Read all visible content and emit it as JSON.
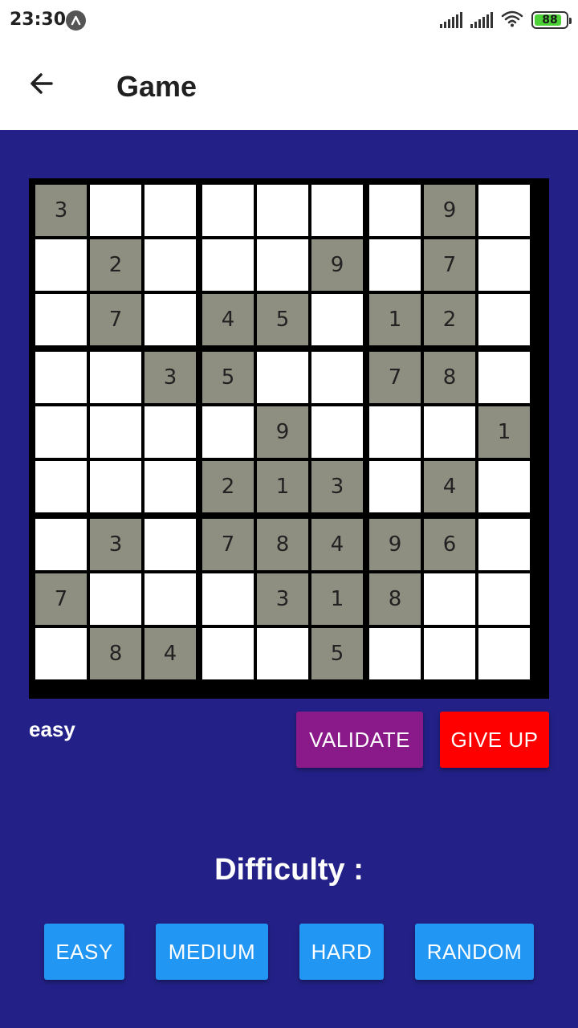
{
  "status_bar": {
    "time": "23:30",
    "battery_level": "88",
    "icons": [
      "app-notification-icon",
      "signal-icon",
      "signal-icon",
      "wifi-icon",
      "battery-icon"
    ]
  },
  "app_bar": {
    "title": "Game",
    "back_icon": "arrow-left-icon"
  },
  "colors": {
    "background": "#232187",
    "given_cell": "#8f8f81",
    "validate_button": "#8a1a8a",
    "give_up_button": "#ff0000",
    "difficulty_button": "#2196f3"
  },
  "board": {
    "grid": [
      [
        3,
        0,
        0,
        0,
        0,
        0,
        0,
        9,
        0
      ],
      [
        0,
        2,
        0,
        0,
        0,
        9,
        0,
        7,
        0
      ],
      [
        0,
        7,
        0,
        4,
        5,
        0,
        1,
        2,
        0
      ],
      [
        0,
        0,
        3,
        5,
        0,
        0,
        7,
        8,
        0
      ],
      [
        0,
        0,
        0,
        0,
        9,
        0,
        0,
        0,
        1
      ],
      [
        0,
        0,
        0,
        2,
        1,
        3,
        0,
        4,
        0
      ],
      [
        0,
        3,
        0,
        7,
        8,
        4,
        9,
        6,
        0
      ],
      [
        7,
        0,
        0,
        0,
        3,
        1,
        8,
        0,
        0
      ],
      [
        0,
        8,
        4,
        0,
        0,
        5,
        0,
        0,
        0
      ]
    ]
  },
  "current_level": "easy",
  "actions": {
    "validate_label": "VALIDATE",
    "give_up_label": "GIVE UP"
  },
  "difficulty": {
    "title": "Difficulty :",
    "options": {
      "easy": "EASY",
      "medium": "MEDIUM",
      "hard": "HARD",
      "random": "RANDOM"
    }
  }
}
